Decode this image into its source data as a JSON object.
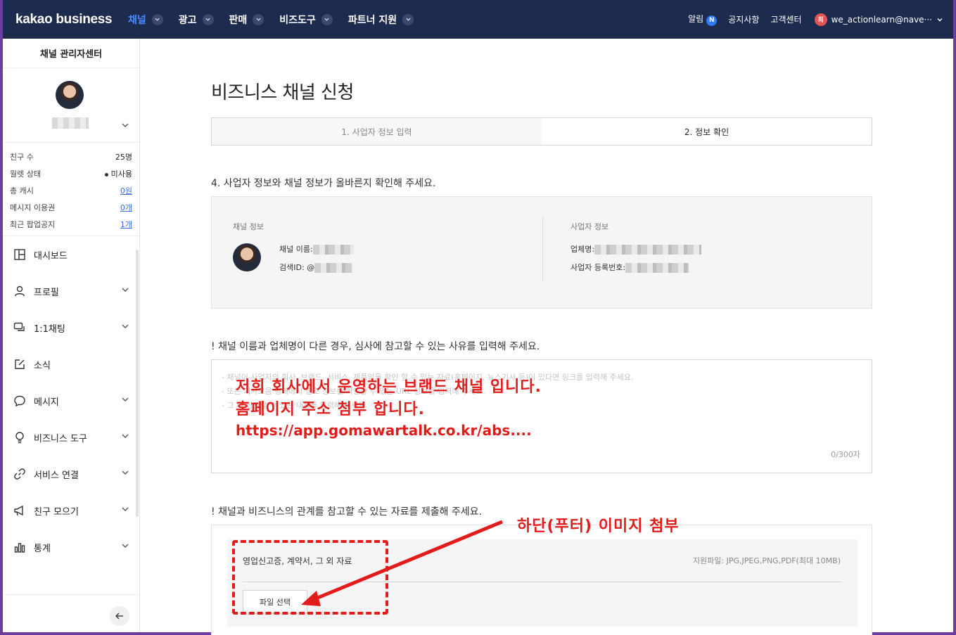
{
  "topnav": {
    "logo": "kakao business",
    "menu": [
      {
        "label": "채널",
        "active": true
      },
      {
        "label": "광고",
        "active": false
      },
      {
        "label": "판매",
        "active": false
      },
      {
        "label": "비즈도구",
        "active": false
      },
      {
        "label": "파트너 지원",
        "active": false
      }
    ],
    "alarm_label": "알림",
    "alarm_badge": "N",
    "notice_label": "공지사항",
    "support_label": "고객센터",
    "user_initial": "최",
    "user_email": "we_actionlearn@nave···"
  },
  "sidebar": {
    "title": "채널 관리자센터",
    "stats": [
      {
        "label": "친구 수",
        "value": "25명",
        "link": false
      },
      {
        "label": "월렛 상태",
        "value": "미사용",
        "link": false,
        "dot": true
      },
      {
        "label": "총 캐시",
        "value": "0원",
        "link": true
      },
      {
        "label": "메시지 이용권",
        "value": "0개",
        "link": true
      },
      {
        "label": "최근 팝업공지",
        "value": "1개",
        "link": true
      }
    ],
    "menu": [
      {
        "label": "대시보드",
        "icon": "dashboard-icon",
        "has_chevron": false
      },
      {
        "label": "프로필",
        "icon": "person-icon",
        "has_chevron": true
      },
      {
        "label": "1:1채팅",
        "icon": "chat-icon",
        "has_chevron": true
      },
      {
        "label": "소식",
        "icon": "edit-icon",
        "has_chevron": false
      },
      {
        "label": "메시지",
        "icon": "speech-bubble-icon",
        "has_chevron": true
      },
      {
        "label": "비즈니스 도구",
        "icon": "lightbulb-icon",
        "has_chevron": true
      },
      {
        "label": "서비스 연결",
        "icon": "link-icon",
        "has_chevron": true
      },
      {
        "label": "친구 모으기",
        "icon": "megaphone-icon",
        "has_chevron": true
      },
      {
        "label": "통계",
        "icon": "bar-chart-icon",
        "has_chevron": true
      }
    ]
  },
  "main": {
    "title": "비즈니스 채널 신청",
    "steps": [
      "1. 사업자 정보 입력",
      "2. 정보 확인"
    ],
    "section4_label": "4. 사업자 정보와 채널 정보가 올바른지 확인해 주세요.",
    "info": {
      "channel_title": "채널 정보",
      "channel_name_label": "채널 이름:",
      "search_id_label": "검색ID: @",
      "business_title": "사업자 정보",
      "company_label": "업체명:",
      "reg_no_label": "사업자 등록번호:"
    },
    "reason_label": "! 채널 이름과 업체명이 다른 경우, 심사에 참고할 수 있는 사유를 입력해 주세요.",
    "reason_placeholder": [
      "- 채널이 사업자의 회사, 브랜드, 서비스, 제품임을 확인 할 수 있는 자료(홈페이지, 뉴스기사 등)이 있다면 링크를 입력해 주세요.",
      "- 또는 기사모음 형태에서 참조 정보를 확인할 수 있는 URL 정보를 입력해 주세요.",
      "- 그 외 참고할 수 있는 내용을 입력해 주세요."
    ],
    "overlay_lines": [
      "저희 회사에서 운영하는 브랜드 채널 입니다.",
      "홈페이지 주소 첨부 합니다."
    ],
    "overlay_url": "https://app.gomawartalk.co.kr/abs....",
    "counter": "0/300자",
    "file_section_label": "! 채널과 비즈니스의 관계를 참고할 수 있는 자료를 제출해 주세요.",
    "file_label": "영업신고증, 계약서, 그 외 자료",
    "file_hint": "지원파일: JPG,JPEG,PNG,PDF(최대 10MB)",
    "file_button": "파일 선택",
    "annotation": "하단(푸터) 이미지 첨부"
  },
  "colors": {
    "nav_bg": "#1d2b4f",
    "nav_active": "#4c8dff",
    "annotation_red": "#e21b1b",
    "frame": "#6b3fa0"
  }
}
